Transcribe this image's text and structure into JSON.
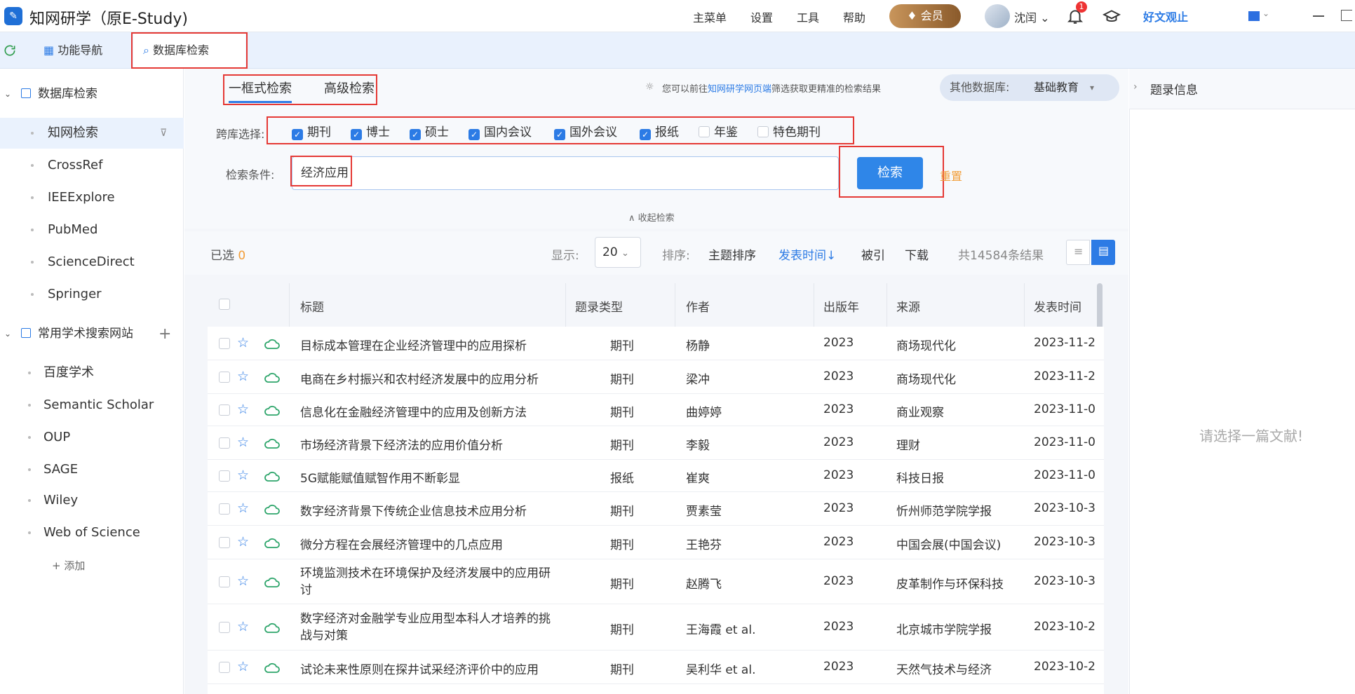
{
  "app": {
    "title": "知网研学（原E-Study)",
    "logo_icon": "graduation-cap-icon"
  },
  "menu": [
    {
      "label": "主菜单"
    },
    {
      "label": "设置"
    },
    {
      "label": "工具"
    },
    {
      "label": "帮助"
    }
  ],
  "vip_label": "会员",
  "user": {
    "name": "沈闰",
    "notification_count": "1"
  },
  "good_text": "好文观止",
  "tabs": [
    {
      "label": "功能导航"
    },
    {
      "label": "数据库检索"
    }
  ],
  "sidebar": {
    "group1": {
      "label": "数据库检索"
    },
    "items1": [
      {
        "label": "知网检索"
      },
      {
        "label": "CrossRef"
      },
      {
        "label": "IEEExplore"
      },
      {
        "label": "PubMed"
      },
      {
        "label": "ScienceDirect"
      },
      {
        "label": "Springer"
      }
    ],
    "group2": {
      "label": "常用学术搜索网站"
    },
    "items2": [
      {
        "label": "百度学术"
      },
      {
        "label": "Semantic Scholar"
      },
      {
        "label": "OUP"
      },
      {
        "label": "SAGE"
      },
      {
        "label": "Wiley"
      },
      {
        "label": "Web of Science"
      }
    ],
    "add_label": "+ 添加"
  },
  "search": {
    "tab_simple": "一框式检索",
    "tab_advanced": "高级检索",
    "tip_prefix": "您可以前往",
    "tip_link": "知网研学网页端",
    "tip_suffix": "筛选获取更精准的检索结果",
    "other_db_label": "其他数据库:",
    "other_db_value": "基础教育",
    "cross_label": "跨库选择:",
    "databases": [
      {
        "label": "期刊",
        "checked": true
      },
      {
        "label": "博士",
        "checked": true
      },
      {
        "label": "硕士",
        "checked": true
      },
      {
        "label": "国内会议",
        "checked": true
      },
      {
        "label": "国外会议",
        "checked": true
      },
      {
        "label": "报纸",
        "checked": true
      },
      {
        "label": "年鉴",
        "checked": false
      },
      {
        "label": "特色期刊",
        "checked": false
      }
    ],
    "cond_label": "检索条件:",
    "query": "经济应用",
    "search_button": "检索",
    "reset_link": "重置",
    "collapse_label": "∧ 收起检索"
  },
  "toolbar": {
    "selected_label": "已选",
    "selected_count": "0",
    "show_label": "显示:",
    "page_size": "20",
    "sort_label": "排序:",
    "sort_options": [
      "主题排序",
      "发表时间↓",
      "被引",
      "下载"
    ],
    "total": "共14584条结果"
  },
  "table": {
    "headers": [
      "标题",
      "题录类型",
      "作者",
      "出版年",
      "来源",
      "发表时间"
    ],
    "rows": [
      {
        "title": "目标成本管理在企业经济管理中的应用探析",
        "type": "期刊",
        "author": "杨静",
        "year": "2023",
        "source": "商场现代化",
        "date": "2023-11-2"
      },
      {
        "title": "电商在乡村振兴和农村经济发展中的应用分析",
        "type": "期刊",
        "author": "梁冲",
        "year": "2023",
        "source": "商场现代化",
        "date": "2023-11-2"
      },
      {
        "title": "信息化在金融经济管理中的应用及创新方法",
        "type": "期刊",
        "author": "曲婷婷",
        "year": "2023",
        "source": "商业观察",
        "date": "2023-11-0"
      },
      {
        "title": "市场经济背景下经济法的应用价值分析",
        "type": "期刊",
        "author": "李毅",
        "year": "2023",
        "source": "理财",
        "date": "2023-11-0"
      },
      {
        "title": "5G赋能赋值赋智作用不断彰显",
        "type": "报纸",
        "author": "崔爽",
        "year": "2023",
        "source": "科技日报",
        "date": "2023-11-0"
      },
      {
        "title": "数字经济背景下传统企业信息技术应用分析",
        "type": "期刊",
        "author": "贾素莹",
        "year": "2023",
        "source": "忻州师范学院学报",
        "date": "2023-10-3"
      },
      {
        "title": "微分方程在会展经济管理中的几点应用",
        "type": "期刊",
        "author": "王艳芬",
        "year": "2023",
        "source": "中国会展(中国会议)",
        "date": "2023-10-3"
      },
      {
        "title": "环境监测技术在环境保护及经济发展中的应用研讨",
        "type": "期刊",
        "author": "赵腾飞",
        "year": "2023",
        "source": "皮革制作与环保科技",
        "date": "2023-10-3"
      },
      {
        "title": "数字经济对金融学专业应用型本科人才培养的挑战与对策",
        "type": "期刊",
        "author": "王海霞 et al.",
        "year": "2023",
        "source": "北京城市学院学报",
        "date": "2023-10-2"
      },
      {
        "title": "试论未来性原则在探井试采经济评价中的应用",
        "type": "期刊",
        "author": "吴利华 et al.",
        "year": "2023",
        "source": "天然气技术与经济",
        "date": "2023-10-2"
      }
    ]
  },
  "right_panel": {
    "title": "题录信息",
    "empty": "请选择一篇文献!"
  },
  "colors": {
    "accent": "#2c7be5",
    "highlight_box": "#e53935",
    "reset": "#f29d38"
  }
}
